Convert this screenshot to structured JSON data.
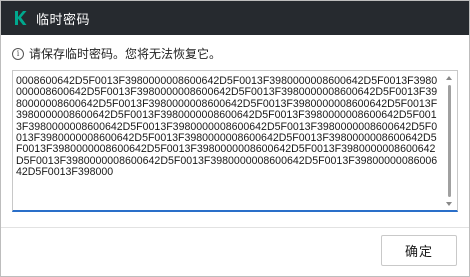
{
  "window": {
    "title": "临时密码",
    "logo_icon": "kaspersky-k-icon",
    "titlebar_color": "#262a2f",
    "logo_color": "#00a88e"
  },
  "notice": {
    "icon": "info-icon",
    "text": "请保存临时密码。您将无法恢复它。"
  },
  "password_field": {
    "value": "0008600642D5F0013F3980000008600642D5F0013F3980000008600642D5F0013F3980000008600642D5F0013F3980000008600642D5F0013F3980000008600642D5F0013F3980000008600642D5F0013F3980000008600642D5F0013F3980000008600642D5F0013F3980000008600642D5F0013F3980000008600642D5F0013F3980000008600642D5F0013F3980000008600642D5F0013F3980000008600642D5F0013F3980000008600642D5F0013F3980000008600642D5F0013F3980000008600642D5F0013F3980000008600642D5F0013F3980000008600642D5F0013F3980000008600642D5F0013F3980000008600642D5F0013F3980000008600642D5F0013F3980000008600642D5F0013F3980000008600642D5F0013F398000",
    "focus_color": "#2a6fc9"
  },
  "footer": {
    "ok_label": "确定"
  }
}
